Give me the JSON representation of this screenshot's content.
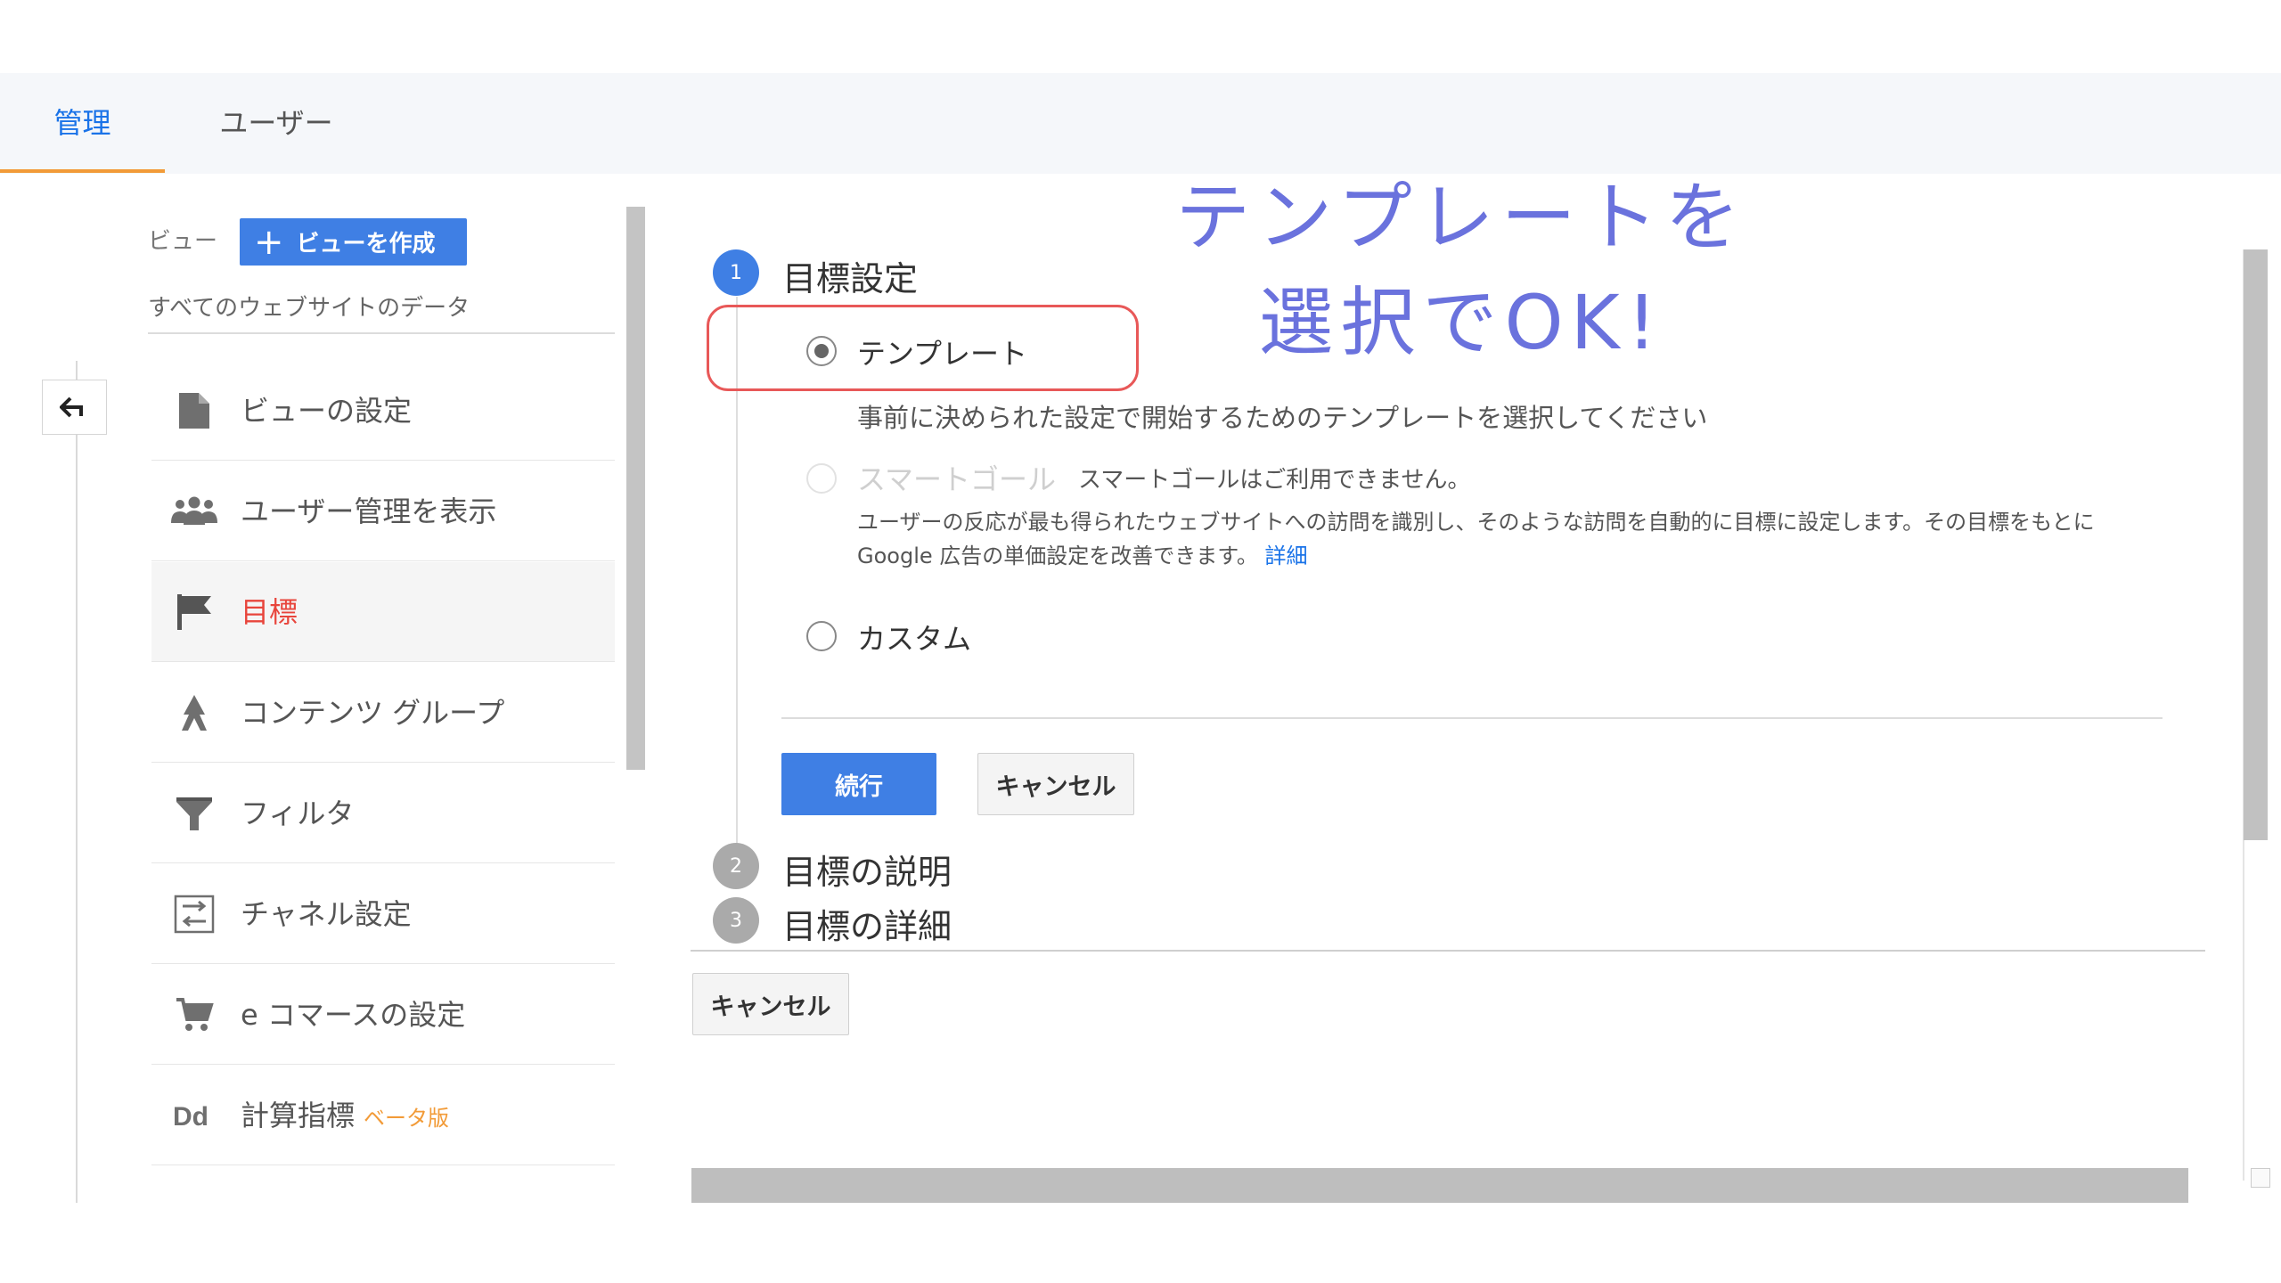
{
  "tabs": [
    {
      "label": "管理",
      "active": true
    },
    {
      "label": "ユーザー",
      "active": false
    }
  ],
  "sidebar": {
    "view_label": "ビュー",
    "create_view_label": "ビューを作成",
    "view_name": "すべてのウェブサイトのデータ",
    "items": [
      {
        "label": "ビューの設定",
        "icon": "document-icon"
      },
      {
        "label": "ユーザー管理を表示",
        "icon": "users-icon"
      },
      {
        "label": "目標",
        "icon": "flag-icon",
        "selected": true
      },
      {
        "label": "コンテンツ グループ",
        "icon": "content-group-icon"
      },
      {
        "label": "フィルタ",
        "icon": "filter-icon"
      },
      {
        "label": "チャネル設定",
        "icon": "channel-settings-icon"
      },
      {
        "label": "e コマースの設定",
        "icon": "cart-icon"
      },
      {
        "label": "計算指標",
        "icon": "dd-icon",
        "badge": "ベータ版"
      }
    ]
  },
  "steps": [
    {
      "number": "1",
      "title": "目標設定"
    },
    {
      "number": "2",
      "title": "目標の説明"
    },
    {
      "number": "3",
      "title": "目標の詳細"
    }
  ],
  "goal_setup": {
    "template_label": "テンプレート",
    "template_desc": "事前に決められた設定で開始するためのテンプレートを選択してください",
    "smart_goal_label": "スマートゴール",
    "smart_goal_note": "スマートゴールはご利用できません。",
    "smart_goal_desc": "ユーザーの反応が最も得られたウェブサイトへの訪問を識別し、そのような訪問を自動的に目標に設定します。その目標をもとに Google 広告の単価設定を改善できます。",
    "smart_goal_link": "詳細",
    "custom_label": "カスタム",
    "selected": "template"
  },
  "buttons": {
    "continue": "続行",
    "cancel": "キャンセル",
    "cancel_bottom": "キャンセル"
  },
  "annotation": {
    "line1": "テンプレートを",
    "line2": "選択でOK!"
  },
  "colors": {
    "accent_blue": "#3f7fe4",
    "selected_red": "#e8453c",
    "tab_underline": "#f29b38",
    "annotation": "#6a72dd",
    "highlight_box": "#e85858"
  }
}
